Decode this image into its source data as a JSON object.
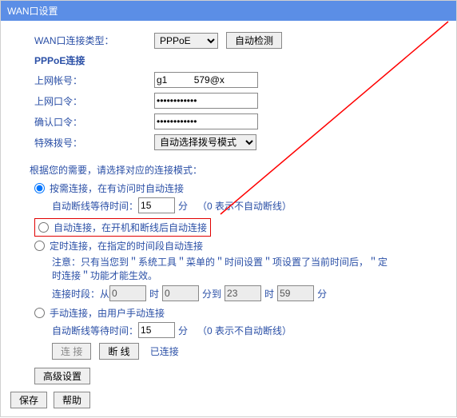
{
  "title": "WAN口设置",
  "wan_type_label": "WAN口连接类型：",
  "wan_type_value": "PPPoE",
  "auto_detect_btn": "自动检测",
  "pppoe_label": "PPPoE连接",
  "account_label": "上网帐号：",
  "account_value": "g1          579@x",
  "password_label": "上网口令：",
  "password_value": "••••••••••••",
  "confirm_label": "确认口令：",
  "confirm_value": "••••••••••••",
  "dial_label": "特殊拨号：",
  "dial_value": "自动选择拨号模式",
  "mode_prompt": "根据您的需要，请选择对应的连接模式：",
  "mode1": "按需连接，在有访问时自动连接",
  "mode1_wait": "自动断线等待时间：",
  "mode1_minutes": "15",
  "mode1_unit": "分",
  "no_disconnect": "（0 表示不自动断线）",
  "mode2": "自动连接，在开机和断线后自动连接",
  "mode3": "定时连接，在指定的时间段自动连接",
  "mode3_note1": "注意：只有当您到＂系统工具＂菜单的＂时间设置＂项设置了当前时间后，＂定",
  "mode3_note2": "时连接＂功能才能生效。",
  "time_label": "连接时段：从",
  "time_h1": "0",
  "time_m1": "0",
  "time_to": "分到",
  "time_h2": "23",
  "time_m2": "59",
  "hour_unit": "时",
  "min_unit": "分",
  "mode4": "手动连接，由用户手动连接",
  "mode4_wait": "自动断线等待时间：",
  "mode4_minutes": "15",
  "connect_btn": "连 接",
  "disconnect_btn": "断 线",
  "status": "已连接",
  "advanced_btn": "高级设置",
  "save_btn": "保存",
  "help_btn": "帮助"
}
